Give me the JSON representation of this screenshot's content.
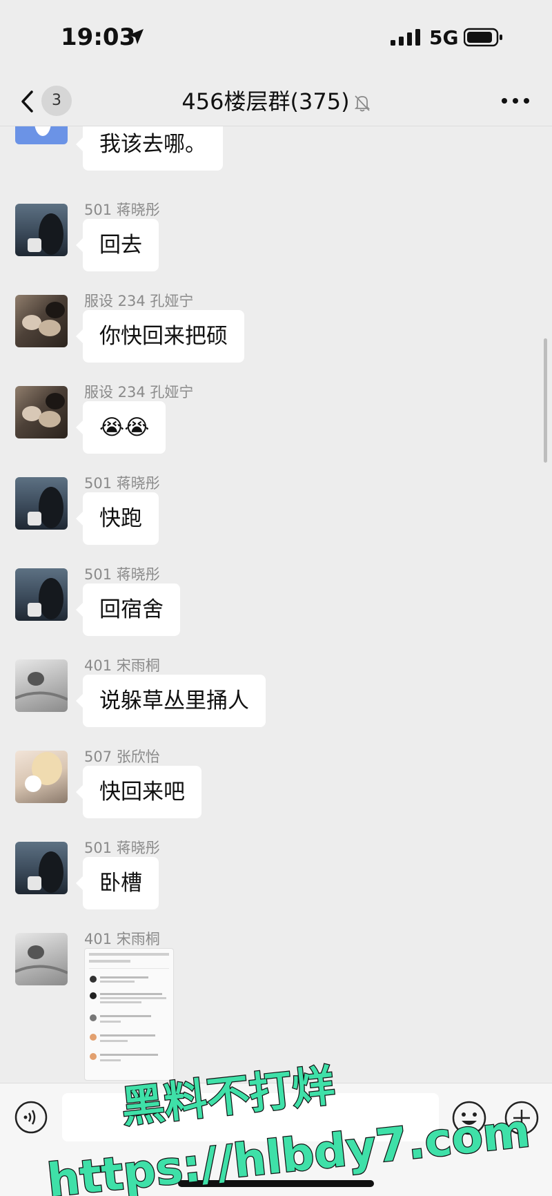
{
  "status_bar": {
    "time": "19:03",
    "network": "5G"
  },
  "nav": {
    "unread_count": "3",
    "title": "456楼层群(375)"
  },
  "messages": [
    {
      "sender": "",
      "text": "我该去哪。",
      "avatar": "rabbit"
    },
    {
      "sender": "501 蒋晓彤",
      "text": "回去",
      "avatar": "sea"
    },
    {
      "sender": "服设 234 孔娅宁",
      "text": "你快回来把硕",
      "avatar": "cats"
    },
    {
      "sender": "服设 234 孔娅宁",
      "text": "😭😭",
      "avatar": "cats"
    },
    {
      "sender": "501 蒋晓彤",
      "text": "快跑",
      "avatar": "sea"
    },
    {
      "sender": "501 蒋晓彤",
      "text": "回宿舍",
      "avatar": "sea"
    },
    {
      "sender": "401 宋雨桐",
      "text": "说躲草丛里捅人",
      "avatar": "gray"
    },
    {
      "sender": "507 张欣怡",
      "text": "快回来吧",
      "avatar": "girl"
    },
    {
      "sender": "501 蒋晓彤",
      "text": "卧槽",
      "avatar": "sea"
    },
    {
      "sender": "401 宋雨桐",
      "text": "",
      "avatar": "gray",
      "attachment": "screenshot-image"
    }
  ],
  "input": {
    "placeholder": ""
  },
  "watermark": {
    "line1": "黑料不打烊",
    "line2": "https://hlbdy7.com",
    "color": "#3fe0a8"
  },
  "colors": {
    "background": "#ededed",
    "bubble": "#ffffff",
    "sender_text": "#8a8a8a"
  }
}
